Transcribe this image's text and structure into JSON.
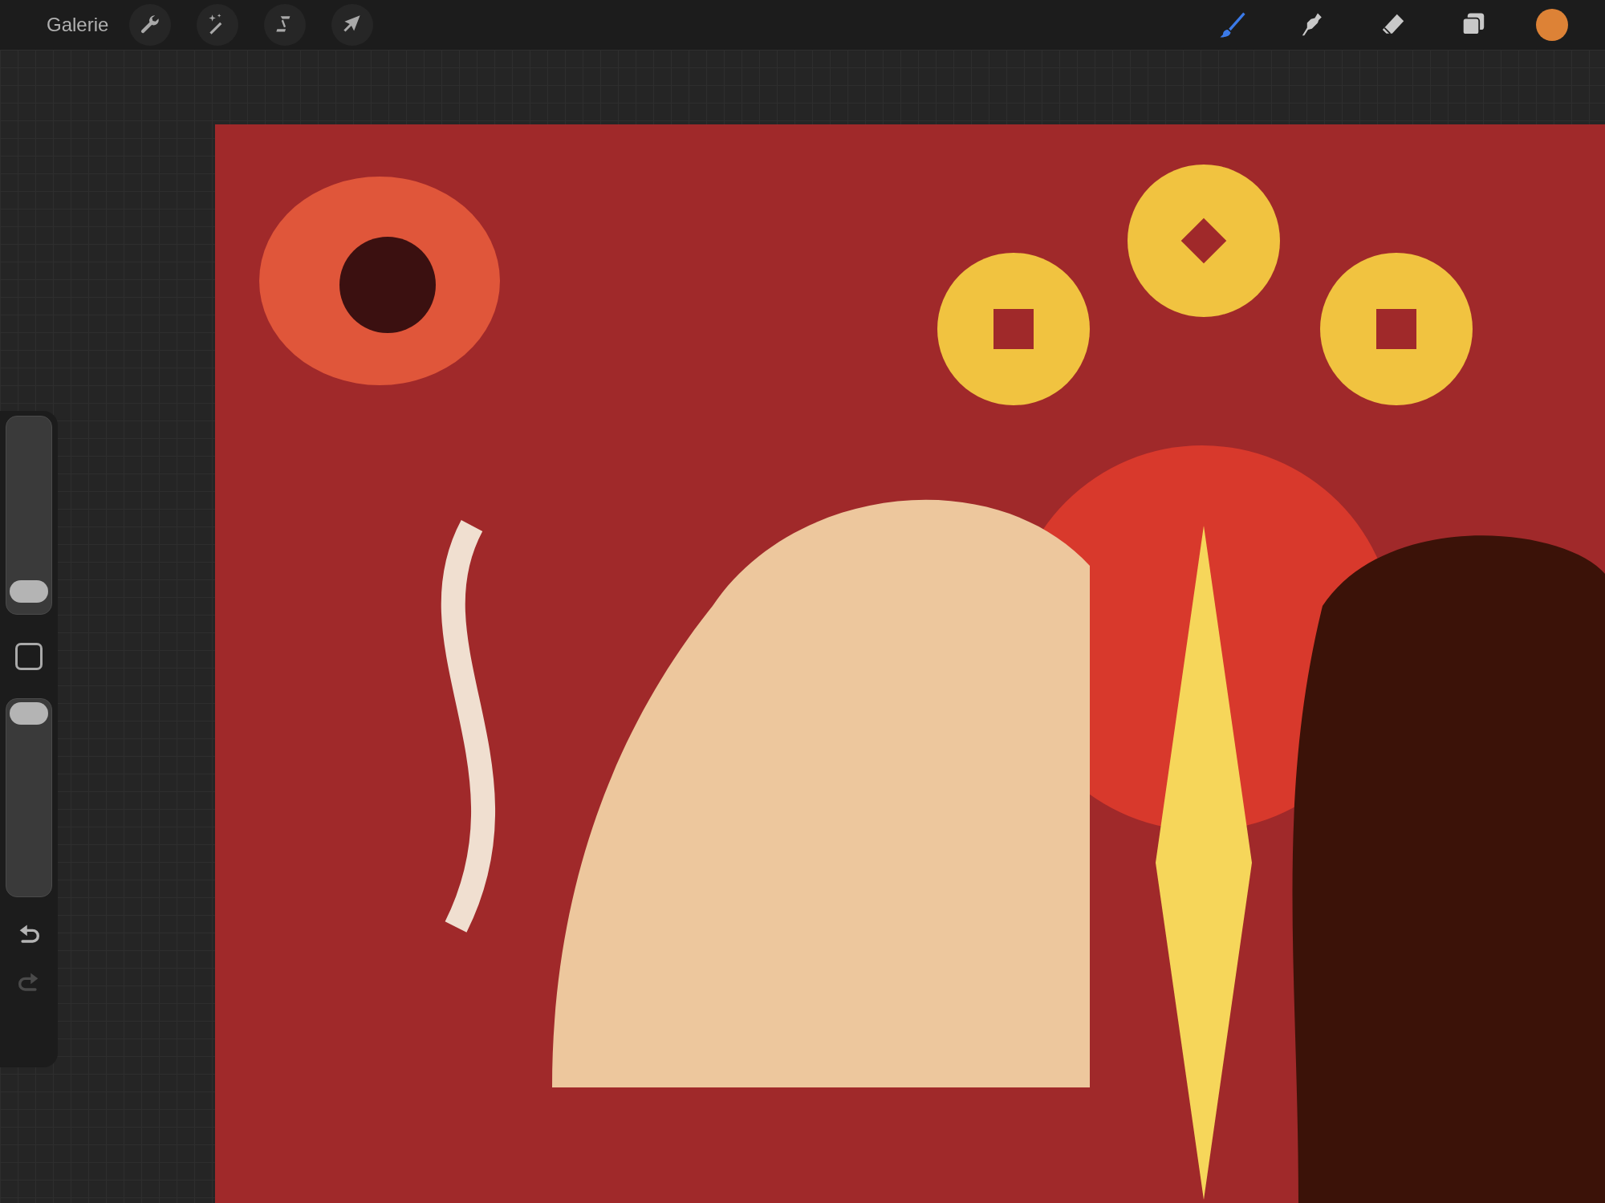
{
  "top_bar": {
    "gallery": "Galerie",
    "actions": [
      {
        "kind": "wrench"
      },
      {
        "kind": "wand"
      },
      {
        "kind": "selection"
      },
      {
        "kind": "arrow"
      }
    ],
    "tools": [
      {
        "kind": "brush",
        "selected": true
      },
      {
        "kind": "smudge",
        "selected": false
      },
      {
        "kind": "eraser",
        "selected": false
      },
      {
        "kind": "layers",
        "selected": false
      }
    ],
    "color_swatch": {
      "color": "#dd8236"
    }
  },
  "sidebar": {
    "brush_size": {
      "level": 0.05
    },
    "opacity": {
      "level": 1
    },
    "undo": {
      "disabled": false
    },
    "redo": {
      "disabled": true
    }
  }
}
